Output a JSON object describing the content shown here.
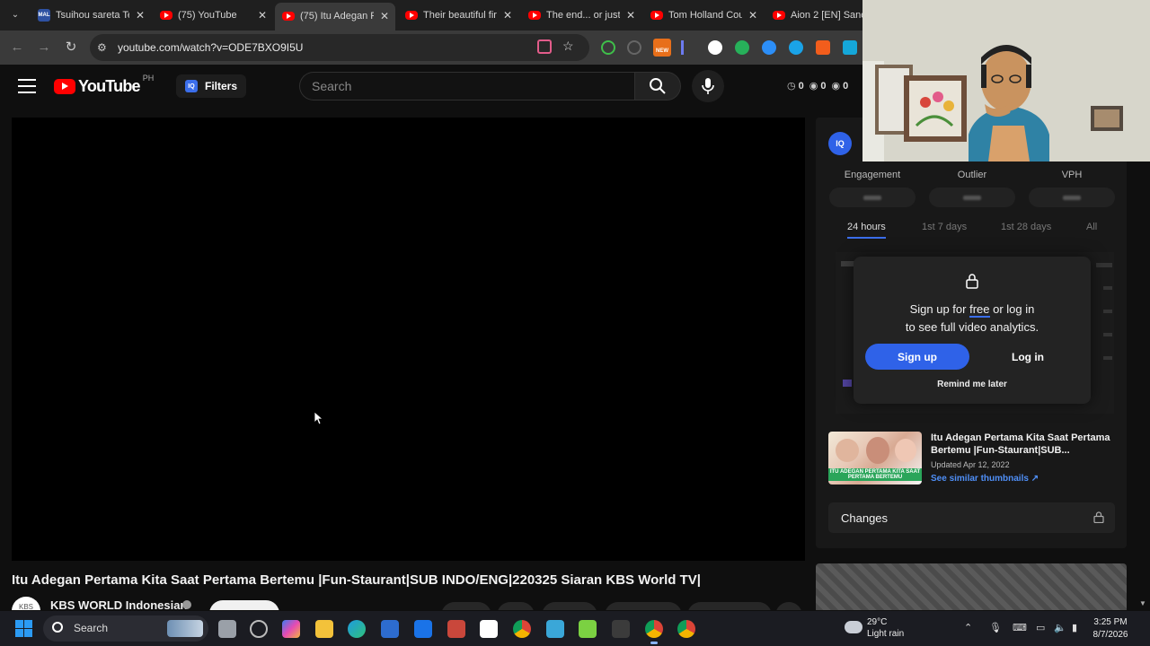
{
  "browser": {
    "tabs": [
      {
        "title": "Tsuihou sareta Te",
        "icon": "mal-favicon",
        "active": false
      },
      {
        "title": "(75) YouTube",
        "icon": "youtube-favicon",
        "active": false
      },
      {
        "title": "(75) Itu Adegan P",
        "icon": "youtube-favicon",
        "active": true
      },
      {
        "title": "Their beautiful fir",
        "icon": "youtube-favicon",
        "active": false
      },
      {
        "title": "The end... or just",
        "icon": "youtube-favicon",
        "active": false
      },
      {
        "title": "Tom Holland Cou",
        "icon": "youtube-favicon",
        "active": false
      },
      {
        "title": "Aion 2 [EN] Sanc",
        "icon": "youtube-favicon",
        "active": false
      }
    ],
    "tab_close": "✕",
    "url": "youtube.com/watch?v=ODE7BXO9I5U",
    "new_badge": "NEW"
  },
  "youtube": {
    "logo_text": "YouTube",
    "country_code": "PH",
    "filters_label": "Filters",
    "iq_label": "IQ",
    "search_placeholder": "Search",
    "stats": [
      "0",
      "0",
      "0"
    ]
  },
  "video": {
    "title": "Itu Adegan Pertama Kita Saat Pertama Bertemu |Fun-Staurant|SUB INDO/ENG|220325 Siaran KBS World TV|",
    "channel_name": "KBS WORLD Indonesian",
    "channel_avatar_text": "KBS"
  },
  "panel": {
    "badge": "IQ",
    "metrics": [
      "Engagement",
      "Outlier",
      "VPH"
    ],
    "tabs": [
      "24 hours",
      "1st 7 days",
      "1st 28 days",
      "All"
    ],
    "active_tab": "24 hours",
    "overlay": {
      "line1_pre": "Sign up for ",
      "line1_link": "free",
      "line1_post": " or log in",
      "line2": "to see full video analytics.",
      "signup": "Sign up",
      "login": "Log in",
      "remind": "Remind me later"
    },
    "thumbnail": {
      "caption": "ITU ADEGAN PERTAMA KITA SAAT PERTAMA BERTEMU",
      "title": "Itu Adegan Pertama Kita Saat Pertama Bertemu |Fun-Staurant|SUB...",
      "updated": "Updated Apr 12, 2022",
      "similar": "See similar thumbnails ↗"
    },
    "changes_label": "Changes"
  },
  "taskbar": {
    "search_label": "Search",
    "weather_temp": "29°C",
    "weather_desc": "Light rain",
    "time": "3:25 PM",
    "date": "8/7/2026"
  }
}
